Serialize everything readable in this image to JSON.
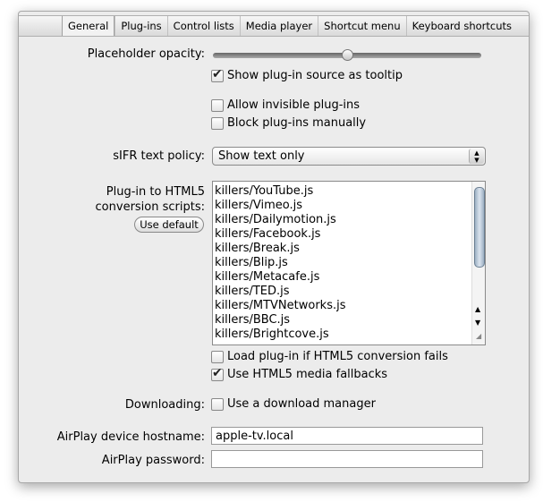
{
  "tabs": [
    "General",
    "Plug-ins",
    "Control lists",
    "Media player",
    "Shortcut menu",
    "Keyboard shortcuts"
  ],
  "selected_tab": "General",
  "placeholder_opacity": {
    "label": "Placeholder opacity:",
    "value_percent": 50
  },
  "show_source_tooltip": {
    "label": "Show plug-in source as tooltip",
    "checked": true
  },
  "allow_invisible": {
    "label": "Allow invisible plug-ins",
    "checked": false
  },
  "block_manually": {
    "label": "Block plug-ins manually",
    "checked": false
  },
  "sifr": {
    "label": "sIFR text policy:",
    "value": "Show text only"
  },
  "conversion": {
    "label1": "Plug-in to HTML5",
    "label2": "conversion scripts:",
    "use_default": "Use default",
    "scripts": [
      "killers/YouTube.js",
      "killers/Vimeo.js",
      "killers/Dailymotion.js",
      "killers/Facebook.js",
      "killers/Break.js",
      "killers/Blip.js",
      "killers/Metacafe.js",
      "killers/TED.js",
      "killers/MTVNetworks.js",
      "killers/BBC.js",
      "killers/Brightcove.js"
    ]
  },
  "load_if_fails": {
    "label": "Load plug-in if HTML5 conversion fails",
    "checked": false
  },
  "html5_fallbacks": {
    "label": "Use HTML5 media fallbacks",
    "checked": true
  },
  "downloading": {
    "label": "Downloading:",
    "option": "Use a download manager",
    "checked": false
  },
  "airplay_host": {
    "label": "AirPlay device hostname:",
    "value": "apple-tv.local"
  },
  "airplay_password": {
    "label": "AirPlay password:",
    "value": ""
  }
}
